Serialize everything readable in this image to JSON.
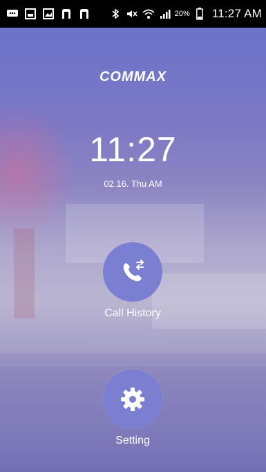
{
  "status_bar": {
    "battery_percent": "20%",
    "time": "11:27 AM",
    "icons": [
      "chat-icon",
      "image-icon",
      "gallery-icon",
      "n-app-icon",
      "n-app-icon",
      "bluetooth-icon",
      "mute-icon",
      "wifi-icon",
      "signal-icon",
      "battery-icon"
    ]
  },
  "app": {
    "brand": "COMMAX",
    "clock": "11:27",
    "date": "02.16. Thu AM",
    "menu": [
      {
        "label": "Call History",
        "icon": "call-history-icon"
      },
      {
        "label": "Setting",
        "icon": "gear-icon"
      }
    ],
    "colors": {
      "button_circle": "#7a7fd2",
      "background_top": "#6b73c9",
      "background_mid": "#a7a1c4"
    }
  }
}
